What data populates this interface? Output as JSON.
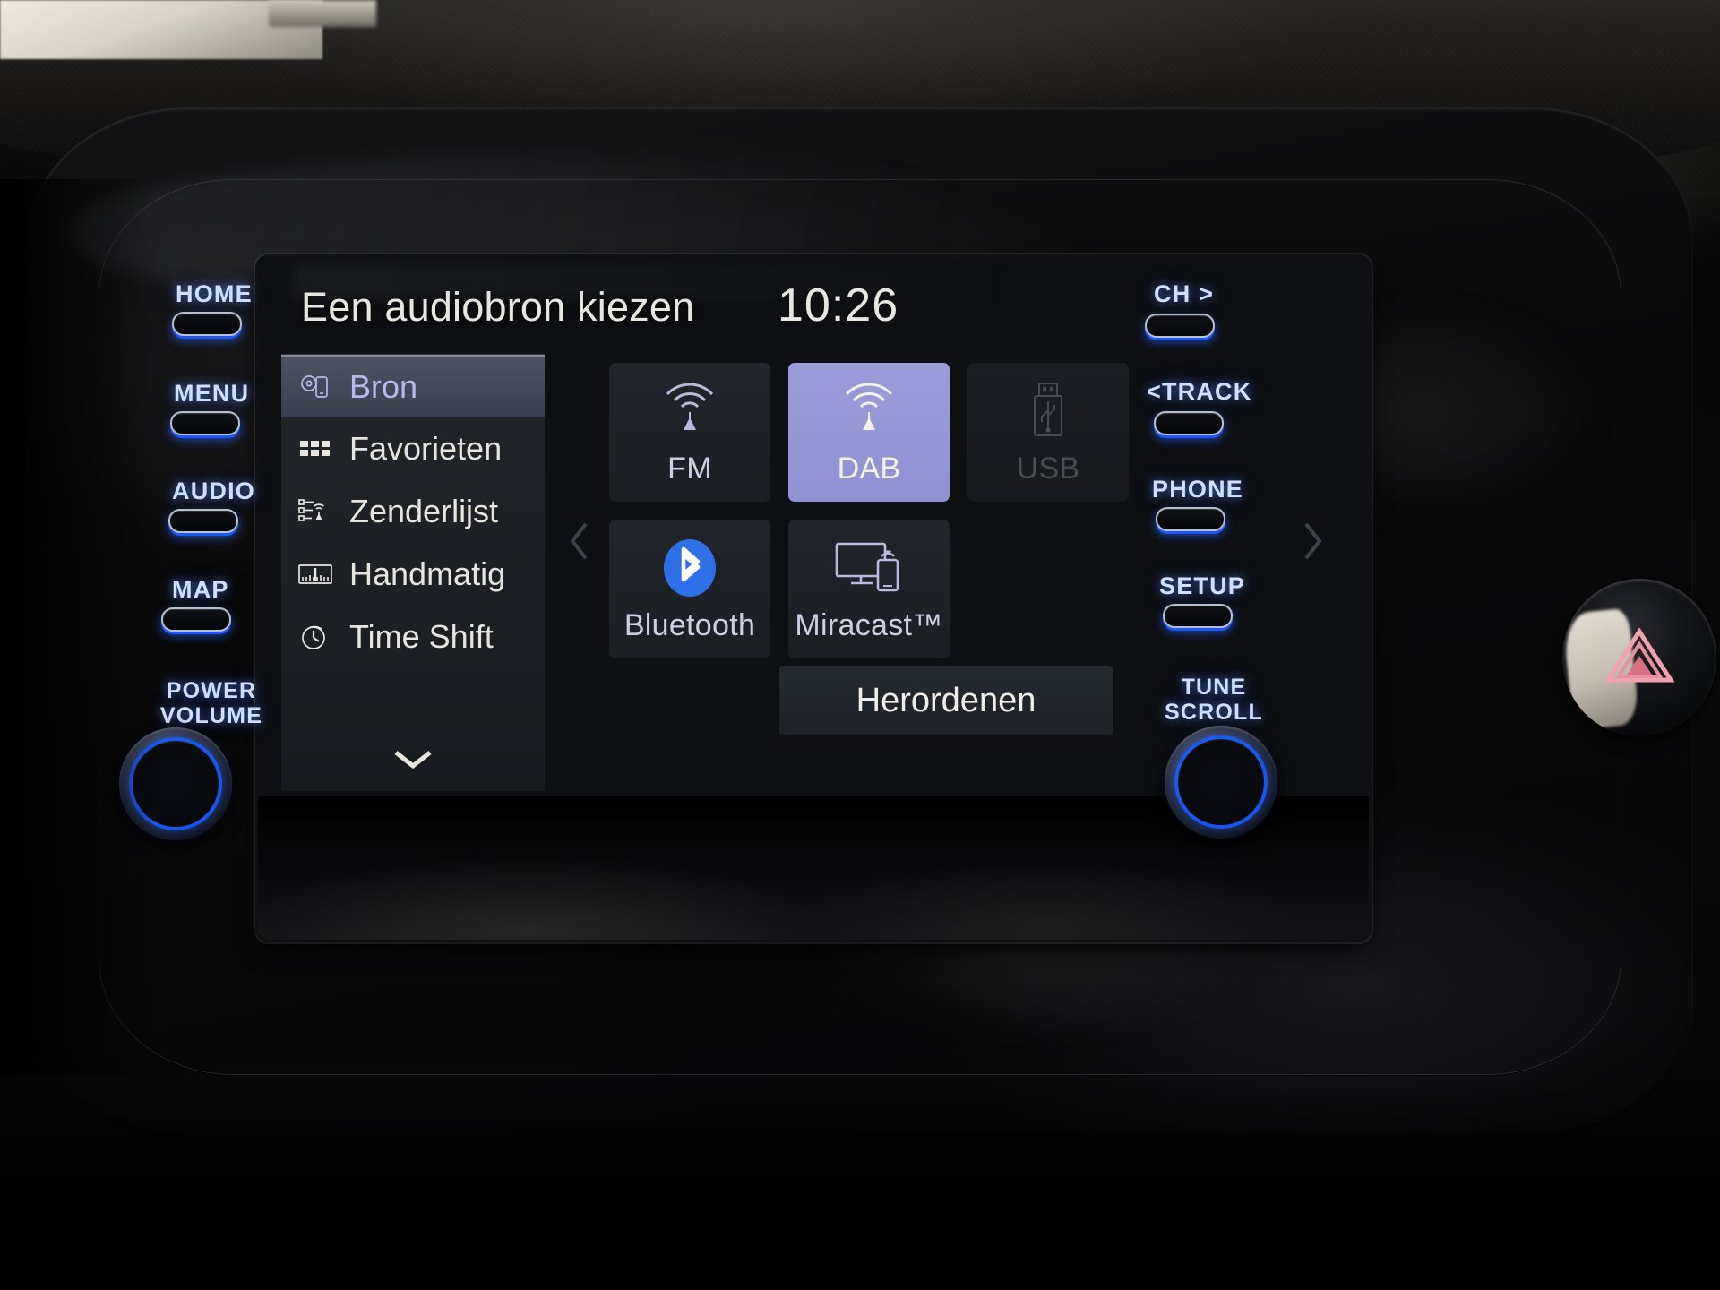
{
  "screen": {
    "header": {
      "title": "Een audiobron kiezen",
      "clock": "10:26"
    },
    "menu": {
      "items": [
        {
          "label": "Bron",
          "icon": "source-phone-icon",
          "selected": true
        },
        {
          "label": "Favorieten",
          "icon": "grid-tiles-icon",
          "selected": false
        },
        {
          "label": "Zenderlijst",
          "icon": "station-list-icon",
          "selected": false
        },
        {
          "label": "Handmatig",
          "icon": "tuning-scale-icon",
          "selected": false
        },
        {
          "label": "Time Shift",
          "icon": "clock-rewind-icon",
          "selected": false
        }
      ],
      "scroll_down_icon": "chevron-down-icon"
    },
    "sources": {
      "prev_page_icon": "chevron-left-icon",
      "next_page_icon": "chevron-right-icon",
      "tiles": [
        {
          "label": "FM",
          "icon": "radio-tower-icon",
          "state": "normal"
        },
        {
          "label": "DAB",
          "icon": "radio-tower-icon",
          "state": "active"
        },
        {
          "label": "USB",
          "icon": "usb-stick-icon",
          "state": "disabled"
        },
        {
          "label": "Bluetooth",
          "icon": "bluetooth-icon",
          "state": "normal"
        },
        {
          "label": "Miracast™",
          "icon": "cast-screen-icon",
          "state": "normal"
        }
      ],
      "reorder_label": "Herordenen"
    },
    "accent_active_tile": "#9b9cd8",
    "accent_selected_menu_text": "#b8b9e8",
    "bluetooth_blue": "#2f6fe8"
  },
  "hardware": {
    "left_buttons": [
      {
        "label": "HOME"
      },
      {
        "label": "MENU"
      },
      {
        "label": "AUDIO"
      },
      {
        "label": "MAP"
      }
    ],
    "left_knob_label_line1": "POWER",
    "left_knob_label_line2": "VOLUME",
    "right_buttons": [
      {
        "label": "CH >"
      },
      {
        "label": "<TRACK"
      },
      {
        "label": "PHONE"
      },
      {
        "label": "SETUP"
      }
    ],
    "right_knob_label_line1": "TUNE",
    "right_knob_label_line2": "SCROLL",
    "hazard_icon": "hazard-triangle-icon"
  }
}
